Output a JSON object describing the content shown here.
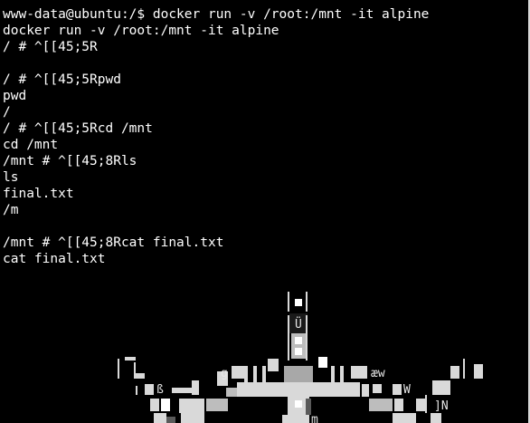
{
  "terminal": {
    "lines": [
      "www-data@ubuntu:/$ docker run -v /root:/mnt -it alpine",
      "docker run -v /root:/mnt -it alpine",
      "/ # ^[[45;5R",
      "",
      "/ # ^[[45;5Rpwd",
      "pwd",
      "/",
      "/ # ^[[45;5Rcd /mnt",
      "cd /mnt",
      "/mnt # ^[[45;8Rls",
      "ls",
      "final.txt",
      "/m",
      "",
      "/mnt # ^[[45;8Rcat final.txt",
      "cat final.txt"
    ],
    "ascii_art_glyphs": [
      "ß",
      "æw",
      "Ü",
      "]N",
      "g",
      "W",
      "m"
    ],
    "colors": {
      "background": "#000000",
      "foreground": "#ffffff",
      "art_light": "#d9d9d9",
      "art_mid": "#a8a8a8",
      "art_dark": "#5a5a5a"
    }
  }
}
